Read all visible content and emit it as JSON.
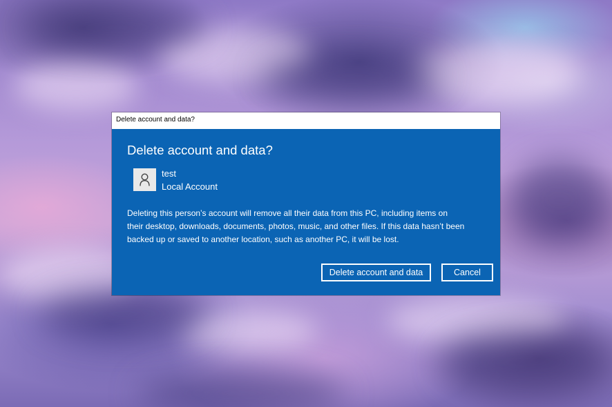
{
  "window": {
    "title": "Delete account and data?"
  },
  "dialog": {
    "heading": "Delete account and data?",
    "user": {
      "name": "test",
      "account_type": "Local Account",
      "avatar_icon": "user-icon"
    },
    "message_lines": [
      "Deleting this person’s account will remove all their data from this PC, including items on",
      "their desktop, downloads, documents, photos, music, and other files. If this data hasn’t been",
      "backed up or saved to another location, such as another PC, it will be lost."
    ],
    "buttons": {
      "delete_label": "Delete account and data",
      "cancel_label": "Cancel"
    },
    "accent_color": "#0b64b4"
  }
}
